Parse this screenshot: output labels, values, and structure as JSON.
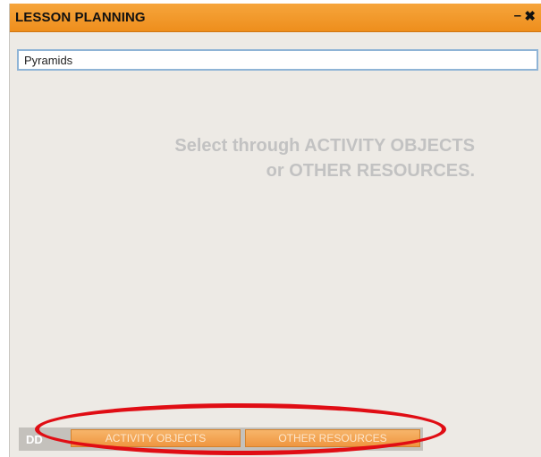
{
  "window": {
    "title": "LESSON PLANNING",
    "minimize_icon": "minimize-icon",
    "close_icon": "close-icon"
  },
  "search": {
    "value": "Pyramids"
  },
  "hint": {
    "line1": "Select through ACTIVITY OBJECTS",
    "line2": "or OTHER RESOURCES."
  },
  "bottom_bar": {
    "add_label": "DD",
    "activity_objects_label": "ACTIVITY OBJECTS",
    "other_resources_label": "OTHER RESOURCES"
  },
  "colors": {
    "titlebar": "#f0961f",
    "panel_bg": "#edeae5",
    "hint_text": "#c2c2c2",
    "tab_button": "#f2a052",
    "annotation": "#e00d14"
  }
}
